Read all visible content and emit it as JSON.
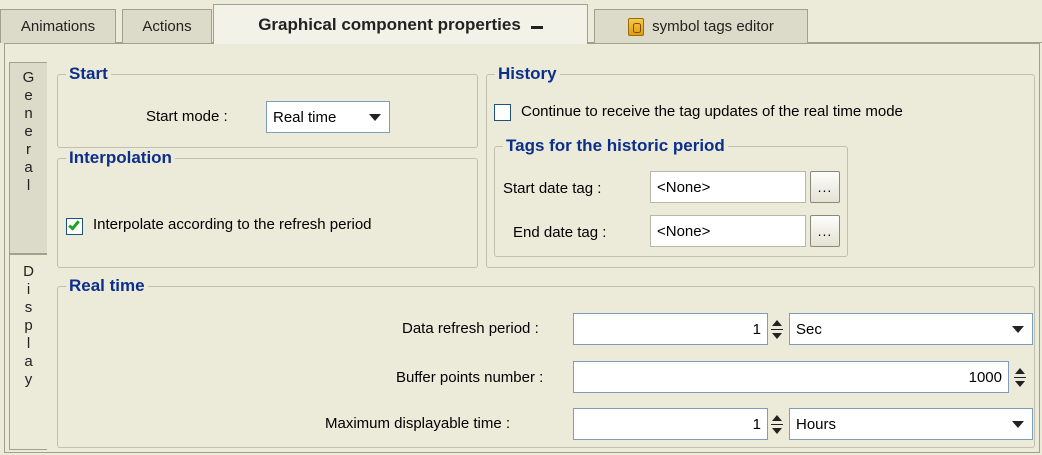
{
  "tabs": [
    {
      "label": "Animations"
    },
    {
      "label": "Actions"
    },
    {
      "label": "Graphical component properties"
    },
    {
      "label": "symbol tags editor"
    }
  ],
  "vertical_tabs": {
    "general": [
      "G",
      "e",
      "n",
      "e",
      "r",
      "a",
      "l"
    ],
    "display": [
      "D",
      "i",
      "s",
      "p",
      "l",
      "a",
      "y"
    ]
  },
  "start": {
    "title": "Start",
    "mode_label": "Start mode :",
    "mode_value": "Real time"
  },
  "interpolation": {
    "title": "Interpolation",
    "checkbox_label": "Interpolate according to the refresh period",
    "checked": true
  },
  "history": {
    "title": "History",
    "continue_label": "Continue to receive the tag updates of the real time mode",
    "continue_checked": false,
    "tags_title": "Tags for the historic period",
    "start_label": "Start date tag :",
    "start_value": "<None>",
    "end_label": "End date tag :",
    "end_value": "<None>",
    "browse_label": "..."
  },
  "realtime": {
    "title": "Real time",
    "refresh_label": "Data refresh period :",
    "refresh_value": "1",
    "refresh_unit": "Sec",
    "buffer_label": "Buffer points number :",
    "buffer_value": "1000",
    "maxtime_label": "Maximum displayable time :",
    "maxtime_value": "1",
    "maxtime_unit": "Hours"
  },
  "colors": {
    "group_title": "#0b2f8a",
    "background": "#ecead9",
    "checkmark": "#21a121"
  }
}
